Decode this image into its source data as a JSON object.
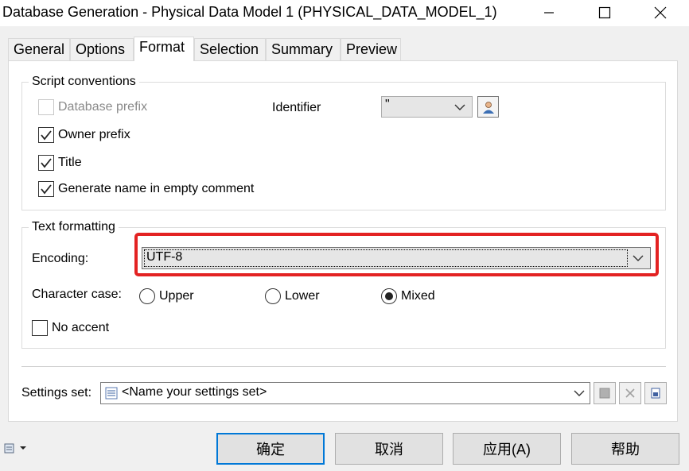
{
  "window": {
    "title": "Database Generation - Physical Data Model 1 (PHYSICAL_DATA_MODEL_1)"
  },
  "tabs": [
    {
      "label": "General",
      "active": false
    },
    {
      "label": "Options",
      "active": false
    },
    {
      "label": "Format",
      "active": true
    },
    {
      "label": "Selection",
      "active": false
    },
    {
      "label": "Summary",
      "active": false
    },
    {
      "label": "Preview",
      "active": false
    }
  ],
  "script_conventions": {
    "title": "Script conventions",
    "database_prefix": {
      "label": "Database prefix",
      "checked": false,
      "enabled": false
    },
    "owner_prefix": {
      "label": "Owner prefix",
      "checked": true
    },
    "title_option": {
      "label": "Title",
      "checked": true
    },
    "generate_name": {
      "label": "Generate name in empty comment",
      "checked": true
    },
    "identifier_label": "Identifier",
    "identifier_value": "\""
  },
  "text_formatting": {
    "title": "Text formatting",
    "encoding_label": "Encoding:",
    "encoding_value": "UTF-8",
    "character_case_label": "Character case:",
    "case_options": [
      {
        "label": "Upper",
        "selected": false
      },
      {
        "label": "Lower",
        "selected": false
      },
      {
        "label": "Mixed",
        "selected": true
      }
    ],
    "no_accent": {
      "label": "No accent",
      "checked": false
    }
  },
  "settings_set": {
    "label": "Settings set:",
    "value": "<Name your settings set>"
  },
  "buttons": {
    "ok": "确定",
    "cancel": "取消",
    "apply": "应用(A)",
    "help": "帮助"
  },
  "colors": {
    "highlight": "#e32222",
    "default_button_border": "#0078d7"
  }
}
